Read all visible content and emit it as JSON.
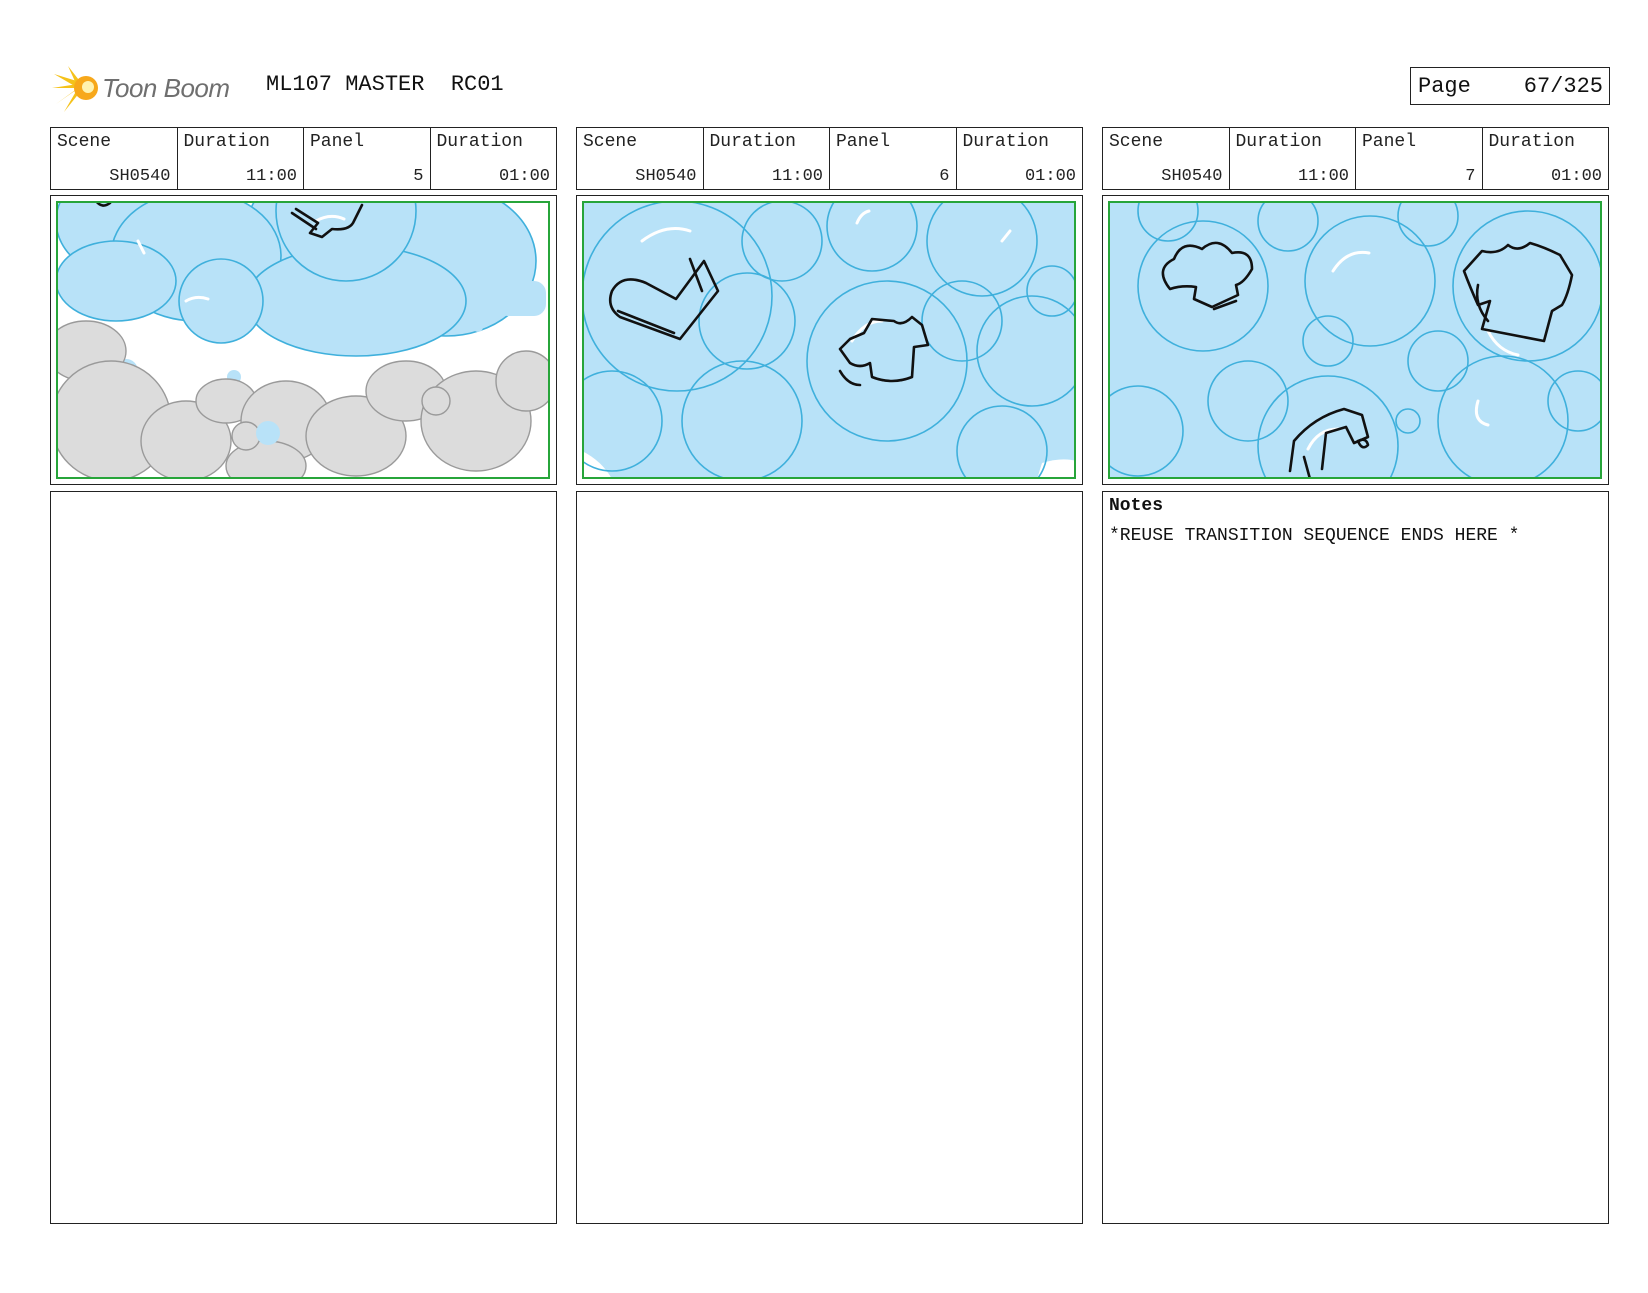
{
  "header": {
    "logo_text": "Toon Boom",
    "title": "ML107 MASTER  RC01",
    "page_label": "Page",
    "page_value": "67/325"
  },
  "panels": [
    {
      "scene_label": "Scene",
      "scene_value": "SH0540",
      "scene_duration_label": "Duration",
      "scene_duration_value": "11:00",
      "panel_label": "Panel",
      "panel_value": "5",
      "panel_duration_label": "Duration",
      "panel_duration_value": "01:00",
      "notes_title": "",
      "notes_text": ""
    },
    {
      "scene_label": "Scene",
      "scene_value": "SH0540",
      "scene_duration_label": "Duration",
      "scene_duration_value": "11:00",
      "panel_label": "Panel",
      "panel_value": "6",
      "panel_duration_label": "Duration",
      "panel_duration_value": "01:00",
      "notes_title": "",
      "notes_text": ""
    },
    {
      "scene_label": "Scene",
      "scene_value": "SH0540",
      "scene_duration_label": "Duration",
      "scene_duration_value": "11:00",
      "panel_label": "Panel",
      "panel_value": "7",
      "panel_duration_label": "Duration",
      "panel_duration_value": "01:00",
      "notes_title": "Notes",
      "notes_text": "*REUSE TRANSITION SEQUENCE ENDS HERE *"
    }
  ],
  "colors": {
    "bubble_fill": "#b8e2f8",
    "bubble_line": "#3fb0dc",
    "foam_fill": "#dcdcdc",
    "foam_line": "#9a9a9a",
    "safe_frame": "#27a53a",
    "logo_star": "#f5c21a"
  }
}
